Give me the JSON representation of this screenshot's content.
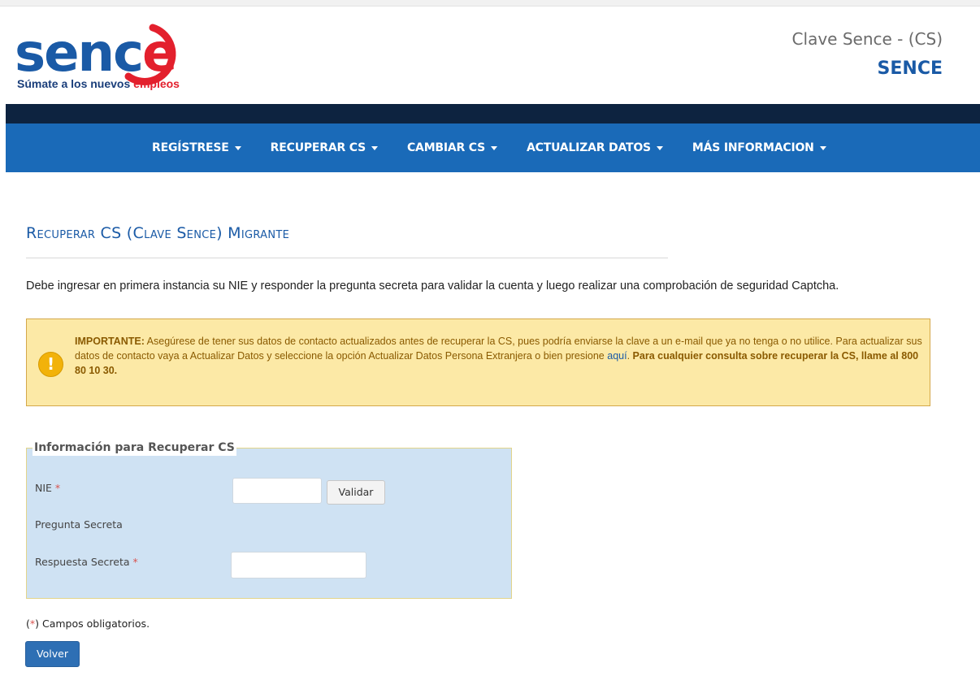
{
  "header": {
    "logo_word_a": "senc",
    "logo_word_b": "e",
    "logo_tagline_a": "Súmate a los nuevos ",
    "logo_tagline_b": "empleos",
    "subtitle": "Clave Sence - (CS)",
    "brand": "SENCE"
  },
  "nav": {
    "items": [
      {
        "label": "REGÍSTRESE"
      },
      {
        "label": "RECUPERAR CS"
      },
      {
        "label": "CAMBIAR CS"
      },
      {
        "label": "ACTUALIZAR DATOS"
      },
      {
        "label": "MÁS INFORMACION"
      }
    ]
  },
  "page": {
    "title": "Recuperar CS (Clave Sence) Migrante",
    "intro": "Debe ingresar en primera instancia su NIE y responder la pregunta secreta para validar la cuenta y luego realizar una comprobación de seguridad Captcha."
  },
  "alert": {
    "icon_glyph": "!",
    "lead": "IMPORTANTE:",
    "text": " Asegúrese de tener sus datos de contacto actualizados antes de recuperar la CS, pues podría enviarse la clave a un e-mail que ya no tenga o no utilice. Para actualizar sus datos de contacto vaya a Actualizar Datos y seleccione la opción Actualizar Datos Persona Extranjera o bien presione ",
    "link": "aquí",
    "dot": ". ",
    "bold_tail": "Para cualquier consulta sobre recuperar la CS, llame al 800 80 10 30."
  },
  "form": {
    "legend": "Información para Recuperar CS",
    "nie_label": "NIE",
    "required_mark": "*",
    "nie_value": "",
    "validate_label": "Validar",
    "question_label": "Pregunta Secreta",
    "answer_label": "Respuesta Secreta",
    "answer_value": ""
  },
  "footer": {
    "note_open": "(",
    "note_mark": "*",
    "note_text": ") Campos obligatorios.",
    "back_label": "Volver"
  },
  "colors": {
    "brand_blue": "#1a5aa6",
    "nav_blue": "#1a6ab8",
    "nav_dark": "#0d2340",
    "alert_bg": "#fce9a6",
    "panel_bg": "#cfe2f3",
    "logo_red": "#e3202d"
  },
  "icons": {
    "nav_caret": "caret-down-icon",
    "alert": "exclamation-circle-icon"
  }
}
